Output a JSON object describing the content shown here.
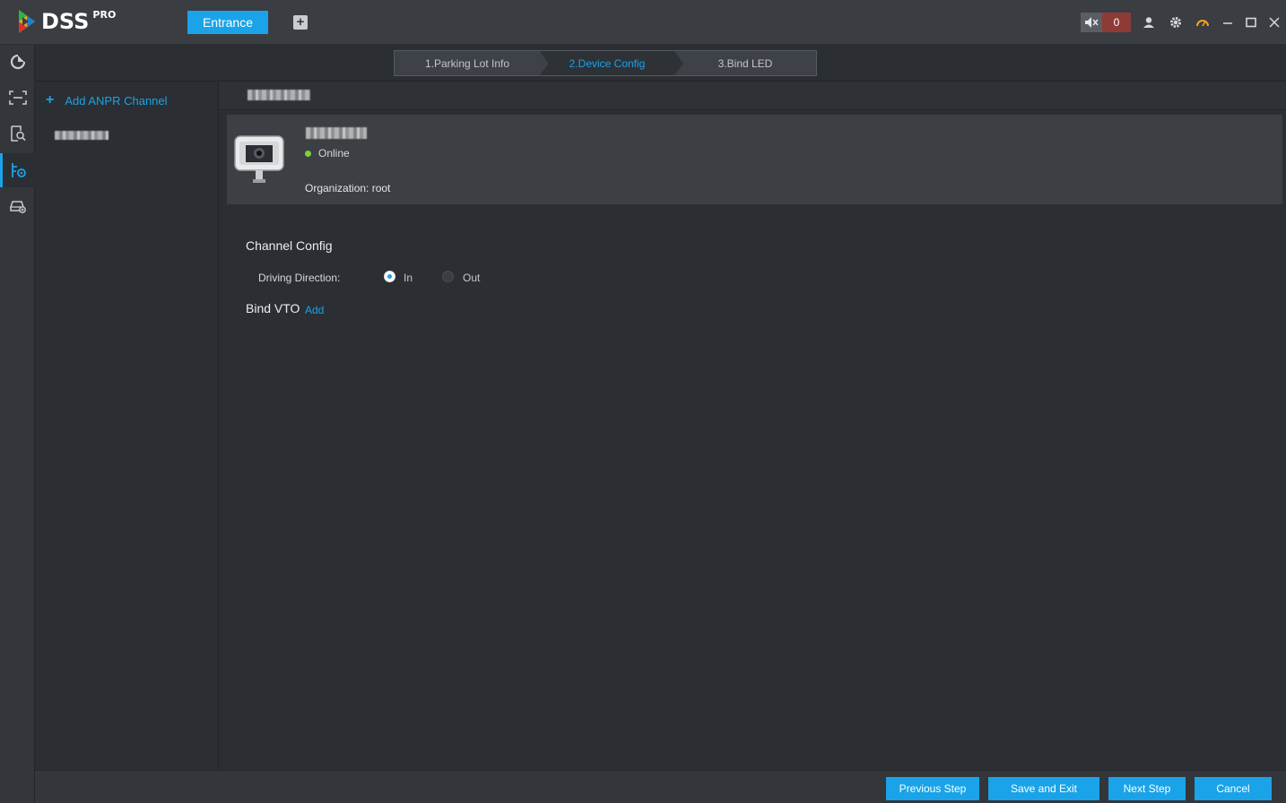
{
  "app": {
    "logo_text": "DSS",
    "logo_sup": "PRO",
    "active_tab": "Entrance",
    "alarm_count": "0"
  },
  "steps": [
    {
      "label": "1.Parking Lot Info",
      "active": false
    },
    {
      "label": "2.Device Config",
      "active": true
    },
    {
      "label": "3.Bind LED",
      "active": false
    }
  ],
  "left_panel": {
    "add_label": "Add ANPR Channel"
  },
  "device": {
    "status": "Online",
    "organization": "Organization: root"
  },
  "channel_config": {
    "title": "Channel Config",
    "driving_direction_label": "Driving Direction:",
    "options": [
      "In",
      "Out"
    ],
    "selected": "In"
  },
  "bind_vto": {
    "title": "Bind VTO",
    "add_label": "Add"
  },
  "footer": {
    "previous": "Previous Step",
    "save_exit": "Save and Exit",
    "next": "Next Step",
    "cancel": "Cancel"
  },
  "colors": {
    "accent": "#1aa3e8",
    "online": "#7cd23a",
    "alarm": "#8e3b36"
  }
}
